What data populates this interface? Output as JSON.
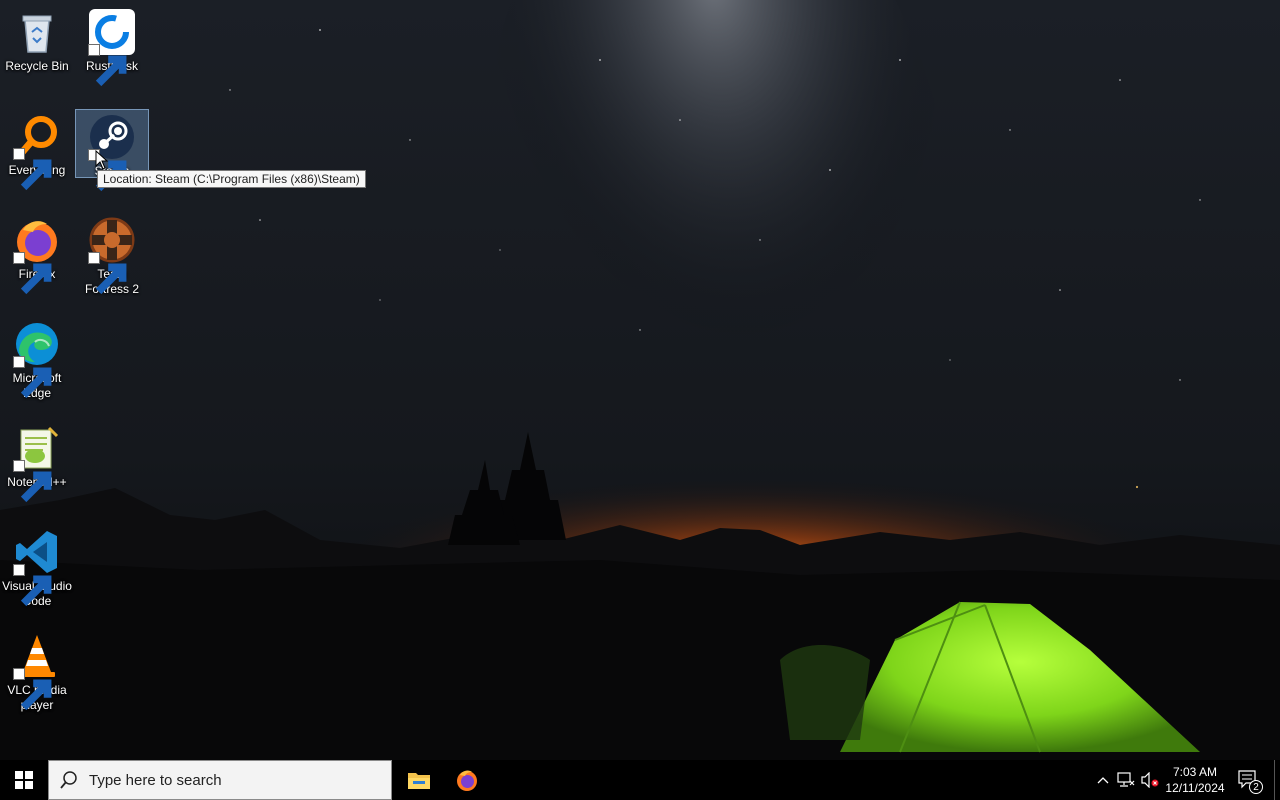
{
  "desktop": {
    "icons": [
      {
        "label": "Recycle Bin"
      },
      {
        "label": "RustDesk"
      },
      {
        "label": "Everything"
      },
      {
        "label": "Steam"
      },
      {
        "label": "Firefox"
      },
      {
        "label": "Team Fortress 2"
      },
      {
        "label": "Microsoft Edge"
      },
      {
        "label": "Notepad++"
      },
      {
        "label": "Visual Studio Code"
      },
      {
        "label": "VLC media player"
      }
    ],
    "tooltip": "Location: Steam (C:\\Program Files (x86)\\Steam)"
  },
  "taskbar": {
    "search_placeholder": "Type here to search",
    "pinned": [
      "file-explorer-icon",
      "firefox-icon"
    ],
    "clock_time": "7:03 AM",
    "clock_date": "12/11/2024",
    "notification_count": "2"
  }
}
